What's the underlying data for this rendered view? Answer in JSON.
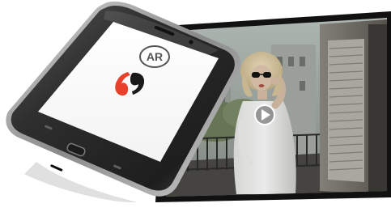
{
  "badge": {
    "text": "AR"
  },
  "icons": {
    "logo": "app-logo-icon",
    "play": "play-icon",
    "home_button": "home-button-icon"
  },
  "colors": {
    "logo_red": "#e8402a",
    "logo_dark": "#1a1a1a",
    "phone_body": "#2b2b2b",
    "play_ring": "#ffffff"
  }
}
